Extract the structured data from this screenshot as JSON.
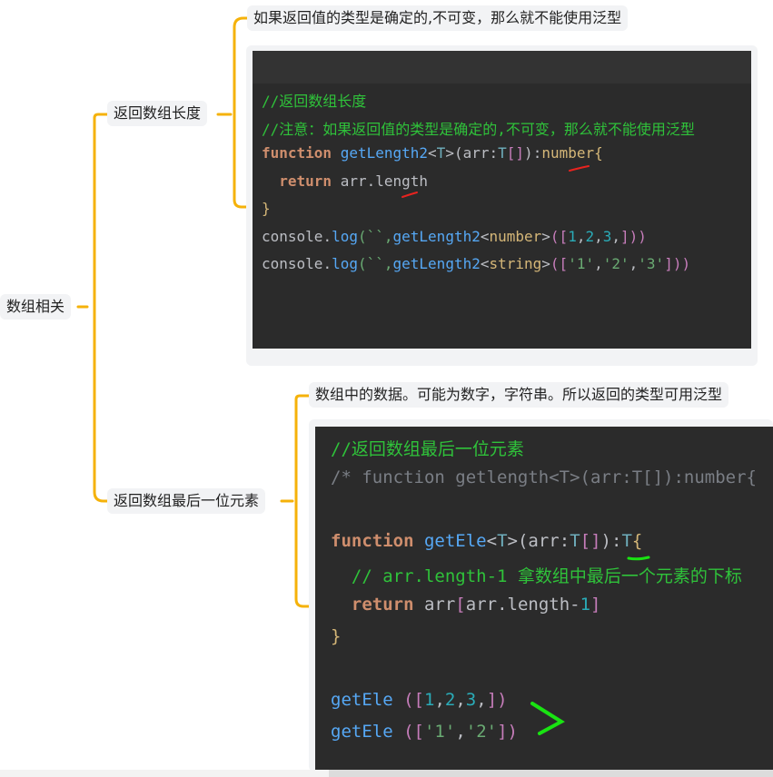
{
  "root": {
    "label": "数组相关"
  },
  "branches": [
    {
      "label": "返回数组长度",
      "note": "如果返回值的类型是确定的,不可变，那么就不能使用泛型",
      "code": {
        "lines": [
          [
            {
              "t": "//返回数组长度",
              "c": "cm"
            }
          ],
          [
            {
              "t": "//注意：如果返回值的类型是确定的,不可变，那么就不能使用泛型",
              "c": "cm"
            }
          ],
          [
            {
              "t": "function",
              "c": "kw"
            },
            {
              "t": " ",
              "c": "pu"
            },
            {
              "t": "getLength2",
              "c": "fn"
            },
            {
              "t": "<",
              "c": "pu"
            },
            {
              "t": "T",
              "c": "ty"
            },
            {
              "t": ">",
              "c": "pu"
            },
            {
              "t": "(",
              "c": "pu"
            },
            {
              "t": "arr",
              "c": "pu"
            },
            {
              "t": ":",
              "c": "pu"
            },
            {
              "t": "T",
              "c": "ty"
            },
            {
              "t": "[]",
              "c": "pl"
            },
            {
              "t": ")",
              "c": "pu"
            },
            {
              "t": ":",
              "c": "pu"
            },
            {
              "t": "number",
              "c": "tag"
            },
            {
              "t": "{",
              "c": "tag"
            }
          ],
          [
            {
              "t": "  ",
              "c": "pu"
            },
            {
              "t": "return",
              "c": "kw"
            },
            {
              "t": " arr.length",
              "c": "pu"
            }
          ],
          [
            {
              "t": "}",
              "c": "tag"
            }
          ],
          [
            {
              "t": "console",
              "c": "pu"
            },
            {
              "t": ".",
              "c": "pu"
            },
            {
              "t": "log",
              "c": "fn"
            },
            {
              "t": "(``,",
              "c": "st"
            },
            {
              "t": "getLength2",
              "c": "fn"
            },
            {
              "t": "<",
              "c": "pu"
            },
            {
              "t": "number",
              "c": "tag"
            },
            {
              "t": ">",
              "c": "pu"
            },
            {
              "t": "([",
              "c": "pl"
            },
            {
              "t": "1",
              "c": "nm"
            },
            {
              "t": ",",
              "c": "pu"
            },
            {
              "t": "2",
              "c": "nm"
            },
            {
              "t": ",",
              "c": "pu"
            },
            {
              "t": "3",
              "c": "nm"
            },
            {
              "t": ",",
              "c": "pu"
            },
            {
              "t": "]))",
              "c": "pl"
            }
          ],
          [
            {
              "t": "console",
              "c": "pu"
            },
            {
              "t": ".",
              "c": "pu"
            },
            {
              "t": "log",
              "c": "fn"
            },
            {
              "t": "(``,",
              "c": "st"
            },
            {
              "t": "getLength2",
              "c": "fn"
            },
            {
              "t": "<",
              "c": "pu"
            },
            {
              "t": "string",
              "c": "tag"
            },
            {
              "t": ">",
              "c": "pu"
            },
            {
              "t": "([",
              "c": "pl"
            },
            {
              "t": "'1'",
              "c": "st"
            },
            {
              "t": ",",
              "c": "pu"
            },
            {
              "t": "'2'",
              "c": "st"
            },
            {
              "t": ",",
              "c": "pu"
            },
            {
              "t": "'3'",
              "c": "st"
            },
            {
              "t": "]))",
              "c": "pl"
            }
          ]
        ]
      }
    },
    {
      "label": "返回数组最后一位元素",
      "note": "数组中的数据。可能为数字，字符串。所以返回的类型可用泛型",
      "code": {
        "lines": [
          [
            {
              "t": "//返回数组最后一位元素",
              "c": "cm"
            }
          ],
          [
            {
              "t": "/* function getlength<T>(arr:T[]):number{",
              "c": "cm-gray"
            }
          ],
          [],
          [
            {
              "t": "function",
              "c": "kw"
            },
            {
              "t": " ",
              "c": "pu"
            },
            {
              "t": "getEle",
              "c": "fn"
            },
            {
              "t": "<",
              "c": "pu"
            },
            {
              "t": "T",
              "c": "ty"
            },
            {
              "t": ">",
              "c": "pu"
            },
            {
              "t": "(",
              "c": "pu"
            },
            {
              "t": "arr",
              "c": "pu"
            },
            {
              "t": ":",
              "c": "pu"
            },
            {
              "t": "T",
              "c": "ty"
            },
            {
              "t": "[]",
              "c": "pl"
            },
            {
              "t": ")",
              "c": "pu"
            },
            {
              "t": ":",
              "c": "pu"
            },
            {
              "t": "T",
              "c": "ty"
            },
            {
              "t": "{",
              "c": "tag"
            }
          ],
          [
            {
              "t": "  ",
              "c": "pu"
            },
            {
              "t": "// arr.length-1 拿数组中最后一个元素的下标",
              "c": "cm"
            }
          ],
          [
            {
              "t": "  ",
              "c": "pu"
            },
            {
              "t": "return",
              "c": "kw"
            },
            {
              "t": " arr",
              "c": "pu"
            },
            {
              "t": "[",
              "c": "pl"
            },
            {
              "t": "arr.length-",
              "c": "pu"
            },
            {
              "t": "1",
              "c": "nm"
            },
            {
              "t": "]",
              "c": "pl"
            }
          ],
          [
            {
              "t": "}",
              "c": "tag"
            }
          ],
          [],
          [
            {
              "t": "getEle",
              "c": "fn"
            },
            {
              "t": " ",
              "c": "pu"
            },
            {
              "t": "([",
              "c": "pl"
            },
            {
              "t": "1",
              "c": "nm"
            },
            {
              "t": ",",
              "c": "pu"
            },
            {
              "t": "2",
              "c": "nm"
            },
            {
              "t": ",",
              "c": "pu"
            },
            {
              "t": "3",
              "c": "nm"
            },
            {
              "t": ",",
              "c": "pu"
            },
            {
              "t": "])",
              "c": "pl"
            }
          ],
          [
            {
              "t": "getEle",
              "c": "fn"
            },
            {
              "t": " ",
              "c": "pu"
            },
            {
              "t": "([",
              "c": "pl"
            },
            {
              "t": "'1'",
              "c": "st"
            },
            {
              "t": ",",
              "c": "pu"
            },
            {
              "t": "'2'",
              "c": "st"
            },
            {
              "t": "])",
              "c": "pl"
            }
          ]
        ]
      }
    }
  ],
  "colors": {
    "connector": "#f5b20a",
    "node_bg": "#f2f3f5",
    "code_bg": "#2b2b2b",
    "red_mark": "#e8231f",
    "green_mark": "#19e312"
  }
}
